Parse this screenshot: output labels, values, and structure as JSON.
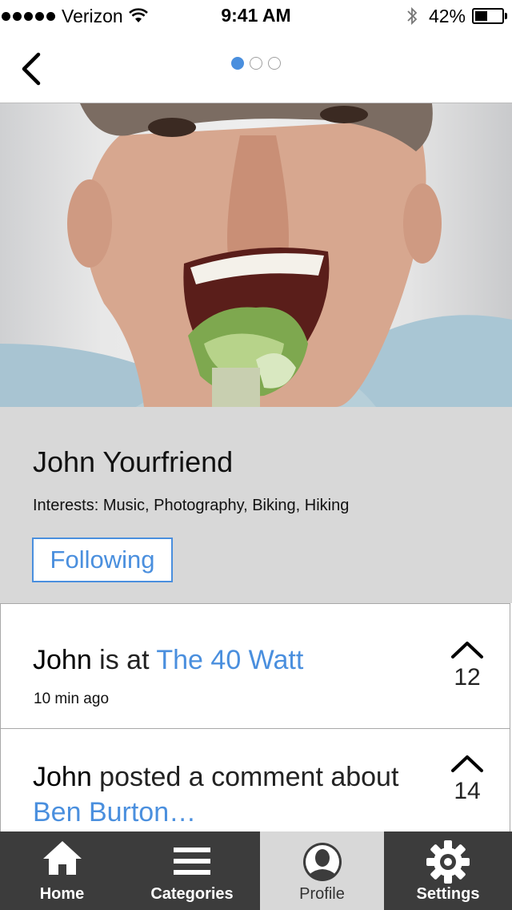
{
  "status_bar": {
    "carrier": "Verizon",
    "time": "9:41 AM",
    "battery": "42%",
    "battery_level": 0.42
  },
  "nav": {
    "back_icon": "chevron-left-icon",
    "pages": 3,
    "active_page": 1
  },
  "profile": {
    "name": "John Yourfriend",
    "interests": "Interests: Music, Photography, Biking, Hiking",
    "follow_label": "Following"
  },
  "feed": [
    {
      "actor": "John",
      "verb": " is at ",
      "link": "The 40 Watt",
      "time": "10 min ago",
      "votes": "12"
    },
    {
      "actor": "John",
      "verb": " posted a comment about ",
      "link": "Ben Burton…",
      "votes": "14"
    }
  ],
  "tabs": {
    "home": "Home",
    "categories": "Categories",
    "profile": "Profile",
    "settings": "Settings"
  },
  "colors": {
    "accent": "#4a8fde",
    "tabbar": "#3c3c3c",
    "selected_tab": "#d8d8d8",
    "info_bg": "#d8d8d8"
  }
}
